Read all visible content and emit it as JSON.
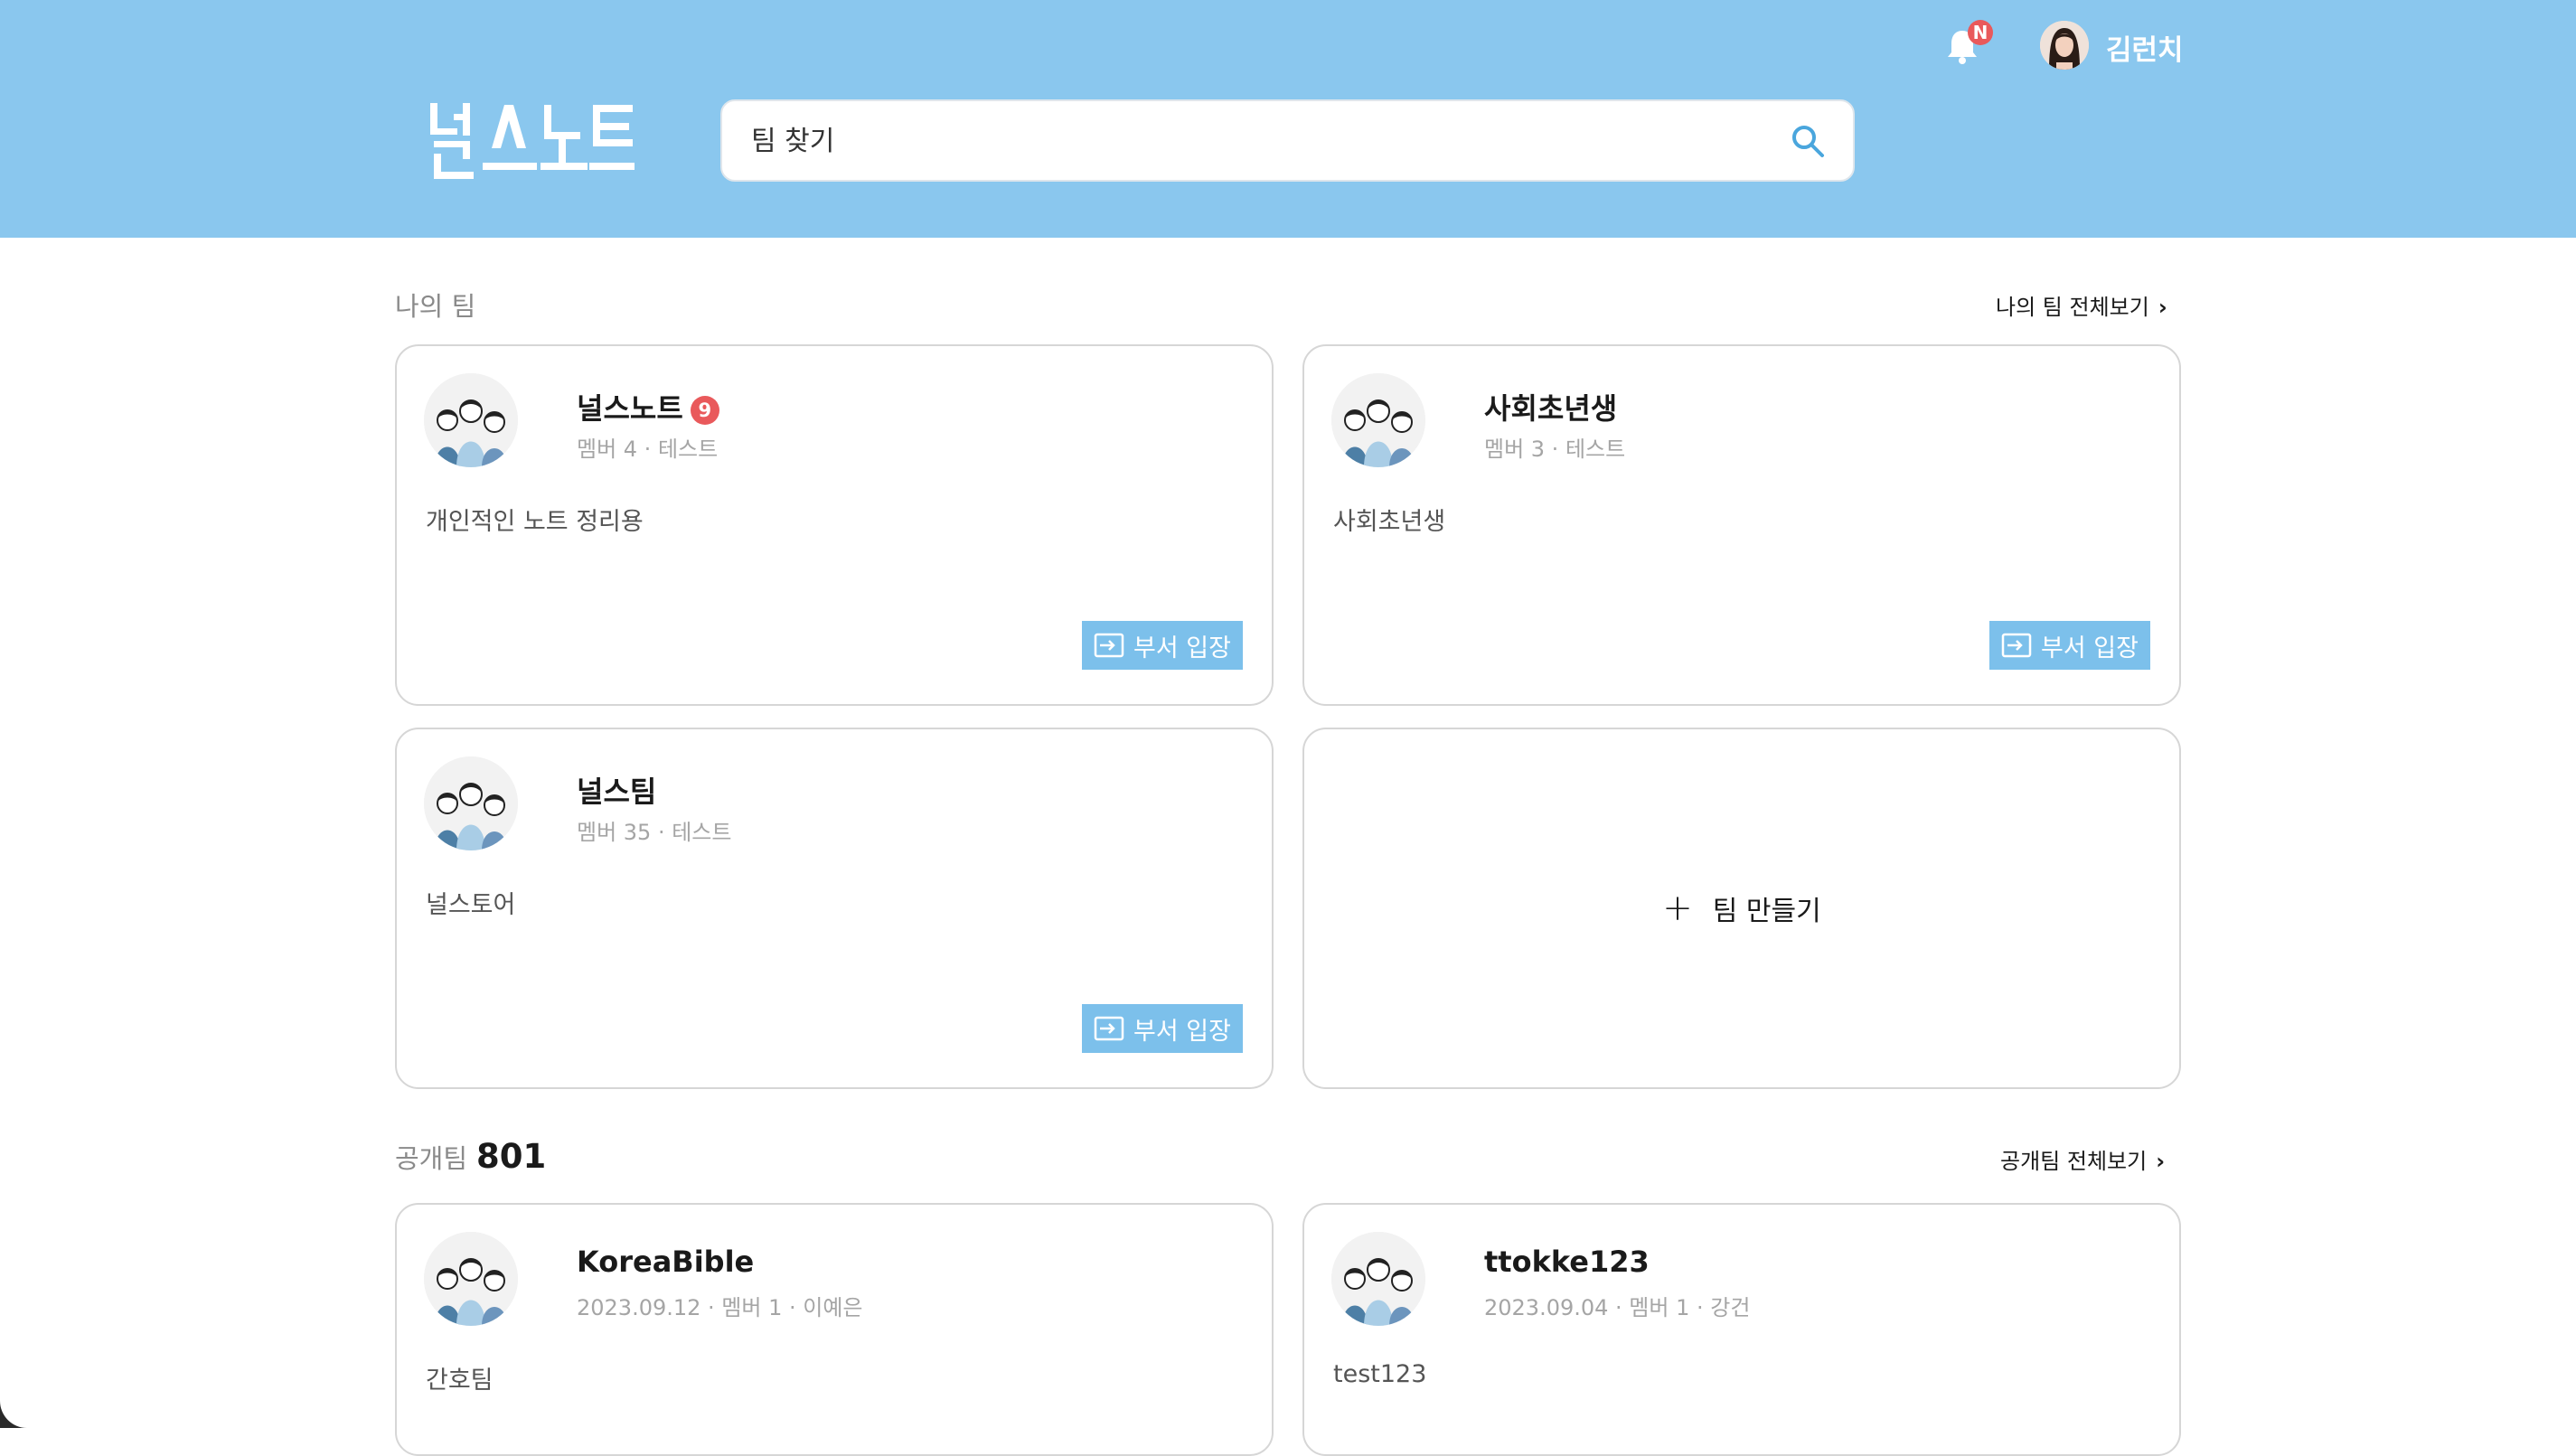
{
  "header": {
    "logo_text": "널스노트",
    "search_placeholder": "팀 찾기",
    "notification_badge": "N",
    "username": "김런치"
  },
  "my_teams": {
    "title": "나의 팀",
    "see_all": "나의 팀 전체보기",
    "enter_label": "부서 입장",
    "create_label": "팀 만들기",
    "teams": [
      {
        "name": "널스노트",
        "badge": "9",
        "meta": "멤버 4 · 테스트",
        "desc": "개인적인 노트 정리용"
      },
      {
        "name": "사회초년생",
        "badge": "",
        "meta": "멤버 3 · 테스트",
        "desc": "사회초년생"
      },
      {
        "name": "널스팀",
        "badge": "",
        "meta": "멤버 35 · 테스트",
        "desc": "널스토어"
      }
    ]
  },
  "public_teams": {
    "title": "공개팀",
    "count": "801",
    "see_all": "공개팀 전체보기",
    "teams": [
      {
        "name": "KoreaBible",
        "meta": "2023.09.12 · 멤버 1 · 이예은",
        "desc": "간호팀"
      },
      {
        "name": "ttokke123",
        "meta": "2023.09.04 · 멤버 1 · 강건",
        "desc": "test123"
      }
    ]
  },
  "colors": {
    "header_bg": "#8ac7ee",
    "button_bg": "#7cc0eb",
    "badge_red": "#e9595b"
  }
}
